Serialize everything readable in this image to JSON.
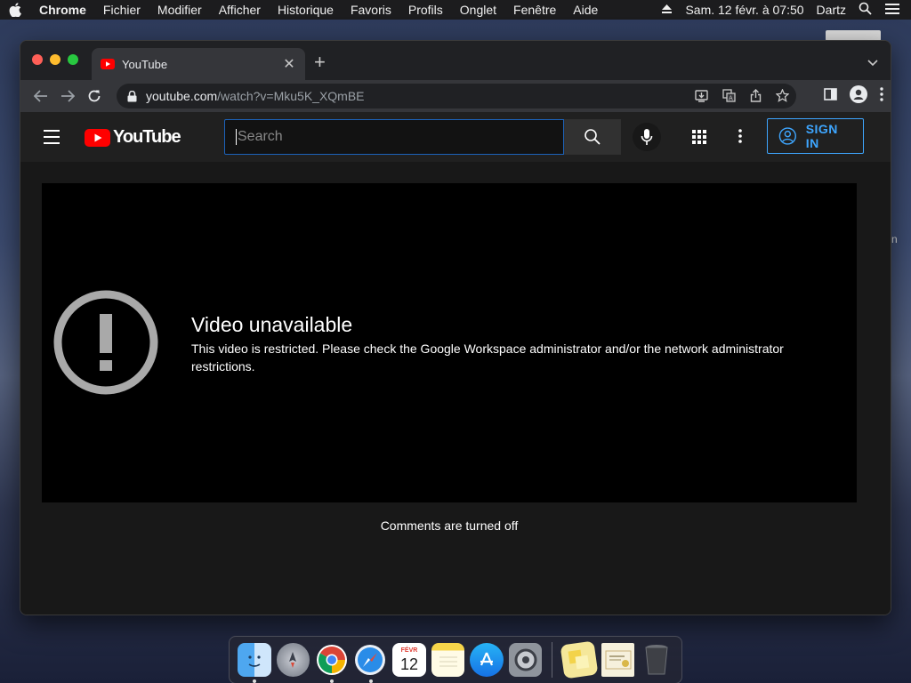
{
  "menubar": {
    "app_name": "Chrome",
    "items": [
      "Fichier",
      "Modifier",
      "Afficher",
      "Historique",
      "Favoris",
      "Profils",
      "Onglet",
      "Fenêtre",
      "Aide"
    ],
    "datetime": "Sam. 12 févr. à  07:50",
    "user": "Dartz"
  },
  "browser": {
    "tab_title": "YouTube",
    "url_host": "youtube.com",
    "url_path": "/watch?v=Mku5K_XQmBE"
  },
  "youtube": {
    "logo_text": "YouTube",
    "search_placeholder": "Search",
    "sign_in_label": "SIGN IN",
    "video_title": "Video unavailable",
    "video_message": "This video is restricted. Please check the Google Workspace administrator and/or the network administrator restrictions.",
    "comments_status": "Comments are turned off"
  },
  "desktop": {
    "partial_text": "n"
  },
  "dock": {
    "calendar_day": "12",
    "calendar_month": "FÉVR",
    "apps": [
      "finder-icon",
      "launchpad-icon",
      "chrome-icon",
      "safari-icon",
      "calendar-icon",
      "notes-icon",
      "app-store-icon",
      "system-preferences-icon",
      "stickies-icon",
      "certificate-icon",
      "trash-icon"
    ]
  },
  "colors": {
    "accent_blue": "#3ea6ff",
    "youtube_red": "#ff0000",
    "page_bg": "#181818"
  }
}
